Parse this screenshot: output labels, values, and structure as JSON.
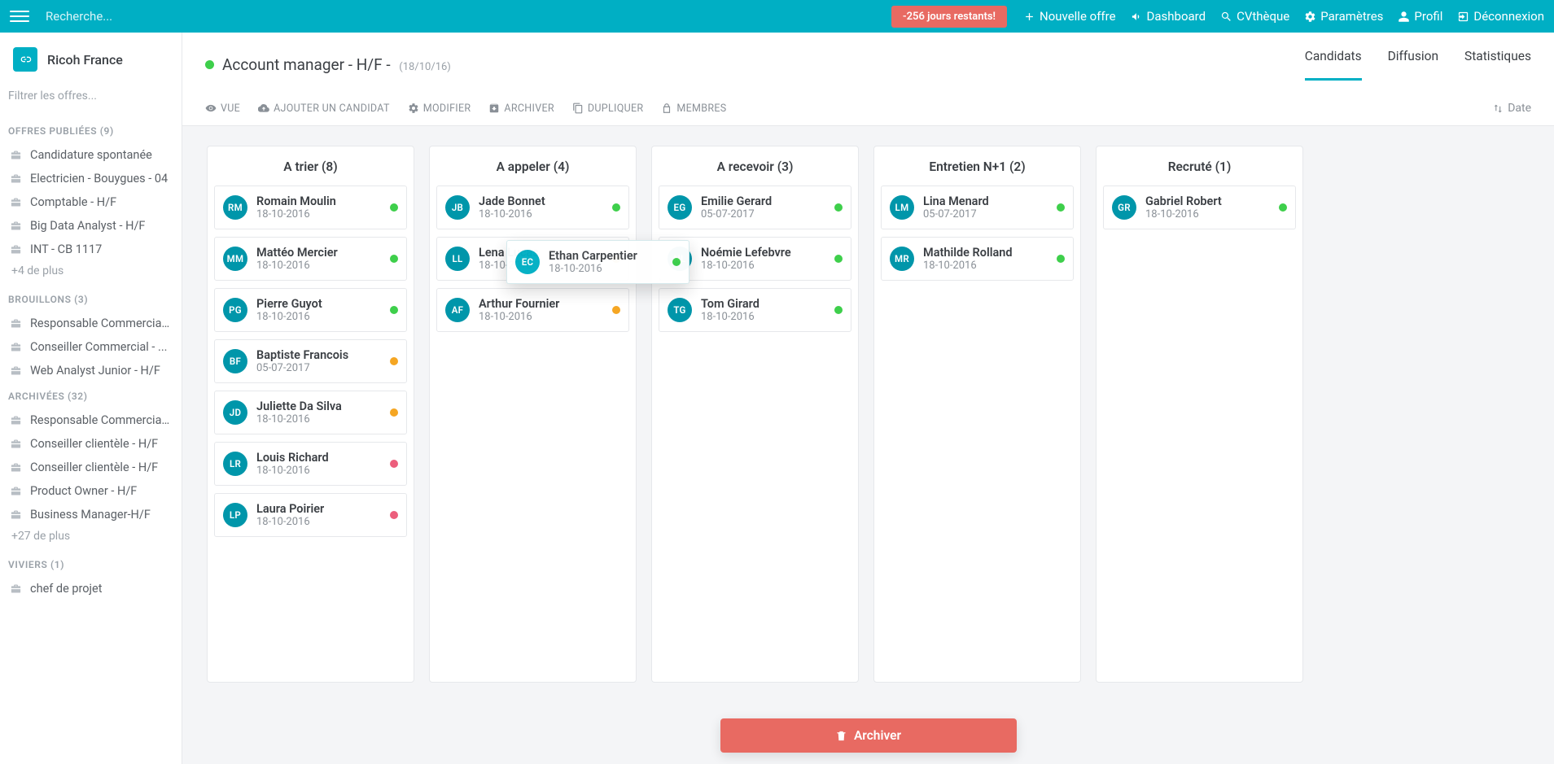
{
  "colors": {
    "teal": "#00afc4",
    "red": "#e86a62",
    "green": "#3ecf4b",
    "orange": "#f5a623",
    "pink": "#ec5e7c"
  },
  "topbar": {
    "search_placeholder": "Recherche...",
    "trial": "-256 jours restants!",
    "nav": {
      "new_offer": "Nouvelle offre",
      "dashboard": "Dashboard",
      "cvtheque": "CVthèque",
      "settings": "Paramètres",
      "profile": "Profil",
      "logout": "Déconnexion"
    }
  },
  "account": {
    "name": "Ricoh France"
  },
  "sidebar": {
    "filter_placeholder": "Filtrer les offres...",
    "sections": {
      "published": {
        "title": "OFFRES PUBLIÉES (9)",
        "more": "+4 de plus",
        "items": [
          "Candidature spontanée",
          "Electricien - Bouygues - 04",
          "Comptable - H/F",
          "Big Data Analyst - H/F",
          "INT - CB 1117"
        ]
      },
      "drafts": {
        "title": "BROUILLONS (3)",
        "items": [
          "Responsable Commercial...",
          "Conseiller Commercial - ...",
          "Web Analyst Junior - H/F"
        ]
      },
      "archived": {
        "title": "ARCHIVÉES (32)",
        "more": "+27 de plus",
        "items": [
          "Responsable Commercial...",
          "Conseiller clientèle - H/F",
          "Conseiller clientèle - H/F",
          "Product Owner - H/F",
          "Business Manager-H/F"
        ]
      },
      "pools": {
        "title": "VIVIERS (1)",
        "items": [
          "chef de projet"
        ]
      }
    }
  },
  "header": {
    "status_color": "#3ecf4b",
    "title": "Account manager - H/F",
    "date": "(18/10/16)",
    "tabs": {
      "candidates": "Candidats",
      "diffusion": "Diffusion",
      "stats": "Statistiques"
    },
    "toolbar": {
      "view": "VUE",
      "add": "AJOUTER UN CANDIDAT",
      "edit": "MODIFIER",
      "archive": "ARCHIVER",
      "duplicate": "DUPLIQUER",
      "members": "MEMBRES"
    },
    "sort_label": "Date"
  },
  "board": {
    "columns": [
      {
        "title": "A trier (8)",
        "cards": [
          {
            "in": "RM",
            "name": "Romain Moulin",
            "date": "18-10-2016",
            "status": "green"
          },
          {
            "in": "MM",
            "name": "Mattéo Mercier",
            "date": "18-10-2016",
            "status": "green"
          },
          {
            "in": "PG",
            "name": "Pierre Guyot",
            "date": "18-10-2016",
            "status": "green"
          },
          {
            "in": "BF",
            "name": "Baptiste Francois",
            "date": "05-07-2017",
            "status": "orange"
          },
          {
            "in": "JD",
            "name": "Juliette Da Silva",
            "date": "18-10-2016",
            "status": "orange"
          },
          {
            "in": "LR",
            "name": "Louis Richard",
            "date": "18-10-2016",
            "status": "pink"
          },
          {
            "in": "LP",
            "name": "Laura Poirier",
            "date": "18-10-2016",
            "status": "pink"
          }
        ]
      },
      {
        "title": "A appeler (4)",
        "cards": [
          {
            "in": "JB",
            "name": "Jade Bonnet",
            "date": "18-10-2016",
            "status": "green"
          },
          {
            "in": "LL",
            "name": "Lena Lucas",
            "date": "18-10-2016",
            "status": "orange"
          },
          {
            "in": "AF",
            "name": "Arthur Fournier",
            "date": "18-10-2016",
            "status": "orange"
          }
        ]
      },
      {
        "title": "A recevoir (3)",
        "cards": [
          {
            "in": "EG",
            "name": "Emilie Gerard",
            "date": "05-07-2017",
            "status": "green"
          },
          {
            "in": "NL",
            "name": "Noémie Lefebvre",
            "date": "18-10-2016",
            "status": "green"
          },
          {
            "in": "TG",
            "name": "Tom Girard",
            "date": "18-10-2016",
            "status": "green"
          }
        ]
      },
      {
        "title": "Entretien N+1 (2)",
        "cards": [
          {
            "in": "LM",
            "name": "Lina Menard",
            "date": "05-07-2017",
            "status": "green"
          },
          {
            "in": "MR",
            "name": "Mathilde Rolland",
            "date": "18-10-2016",
            "status": "green"
          }
        ]
      },
      {
        "title": "Recruté (1)",
        "cards": [
          {
            "in": "GR",
            "name": "Gabriel Robert",
            "date": "18-10-2016",
            "status": "green"
          }
        ]
      }
    ]
  },
  "drag_card": {
    "in": "EC",
    "name": "Ethan Carpentier",
    "date": "18-10-2016",
    "status": "green"
  },
  "archive_button": "Archiver"
}
